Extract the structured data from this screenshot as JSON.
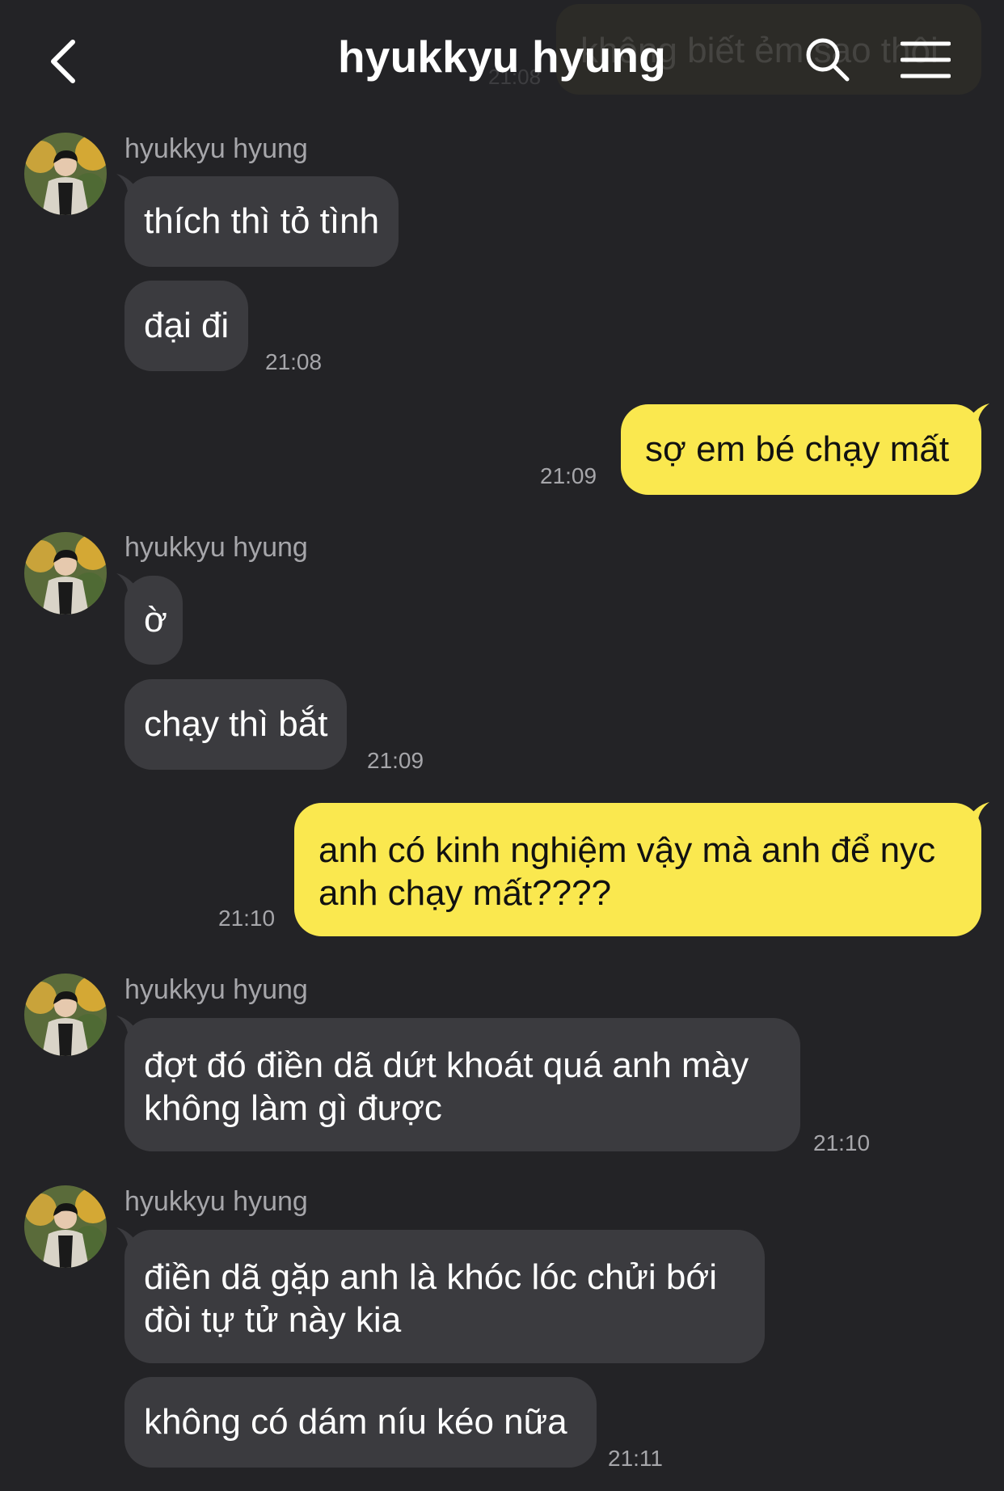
{
  "header": {
    "title": "hyukkyu hyung",
    "back_icon": "chevron-left-icon",
    "search_icon": "search-icon",
    "menu_icon": "hamburger-menu-icon"
  },
  "background_overlap": {
    "text": "không biết ẻm sao thôi",
    "time": "21:08"
  },
  "colors": {
    "background": "#232326",
    "incoming_bubble": "#3b3b3f",
    "outgoing_bubble": "#fae84f",
    "meta_text": "#a6a6aa"
  },
  "messages": [
    {
      "sender": "hyukkyu hyung",
      "text": "thích thì tỏ tình"
    },
    {
      "text": "đại đi",
      "time": "21:08"
    },
    {
      "text": "sợ em bé chạy mất",
      "time": "21:09"
    },
    {
      "sender": "hyukkyu hyung",
      "text": "ờ"
    },
    {
      "text": "chạy thì bắt",
      "time": "21:09"
    },
    {
      "line1": "anh có kinh nghiệm vậy mà anh để nyc",
      "line2": "anh chạy mất????",
      "time": "21:10"
    },
    {
      "sender": "hyukkyu hyung",
      "line1": "đợt đó điền dã dứt khoát quá anh mày",
      "line2": "không làm gì được",
      "time": "21:10"
    },
    {
      "sender": "hyukkyu hyung",
      "line1": "điền dã gặp anh là khóc lóc chửi bới",
      "line2": "đòi tự tử này kia"
    },
    {
      "text": "không có dám níu kéo nữa",
      "time": "21:11"
    }
  ]
}
